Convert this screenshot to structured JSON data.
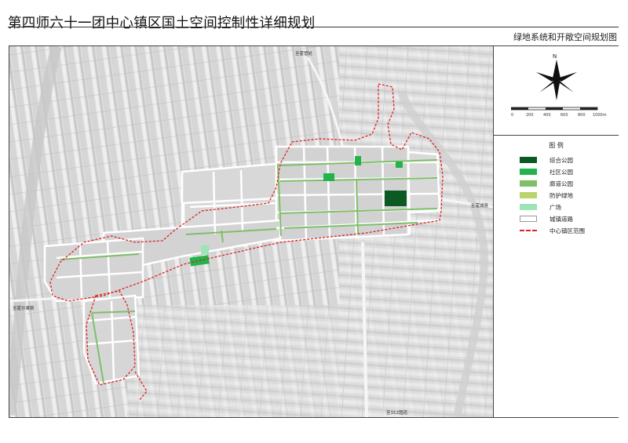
{
  "title": "第四师六十一团中心镇区国土空间控制性详细规划",
  "subtitle": "绿地系统和开敞空间规划图",
  "north": "N",
  "scale_ticks": [
    "0",
    "200",
    "400",
    "600",
    "800",
    "1000m"
  ],
  "legend": {
    "title": "图    例",
    "items": [
      {
        "label": "综合公园",
        "color": "#0b5a23"
      },
      {
        "label": "社区公园",
        "color": "#22b34c"
      },
      {
        "label": "廊道公园",
        "color": "#7fbf6a"
      },
      {
        "label": "防护绿地",
        "color": "#b9d46b"
      },
      {
        "label": "广场",
        "color": "#9fe3b8"
      },
      {
        "label": "城镇道路",
        "color": "#ffffff"
      },
      {
        "label": "中心镇区范围",
        "color": "#e02020"
      }
    ]
  },
  "road_labels": {
    "north": "至霍管处",
    "east": "至霍城县",
    "west": "至霍尔果斯",
    "south": "至312国道"
  }
}
